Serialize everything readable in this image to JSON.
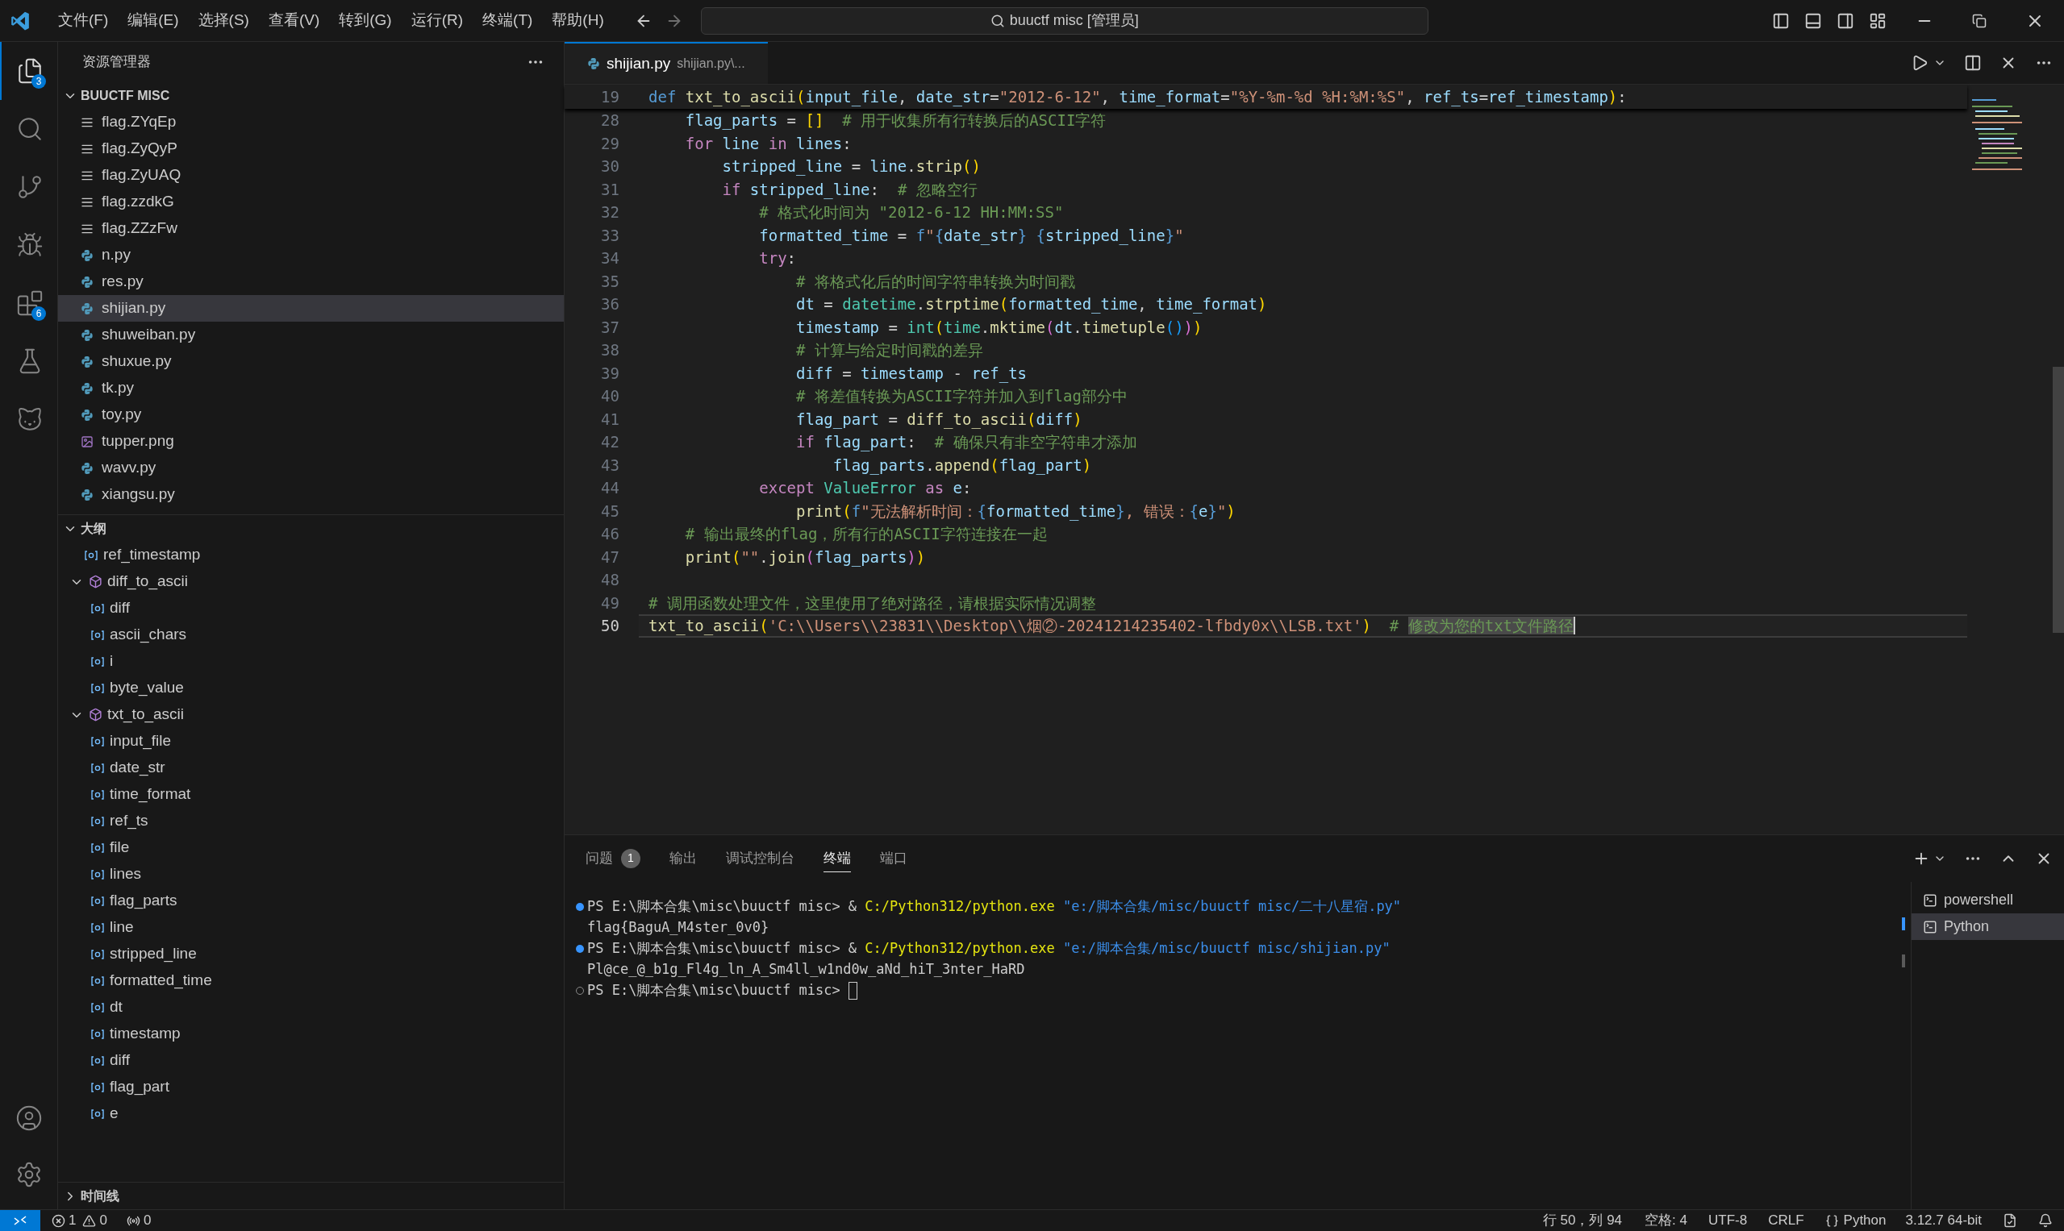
{
  "menu": [
    "文件(F)",
    "编辑(E)",
    "选择(S)",
    "查看(V)",
    "转到(G)",
    "运行(R)",
    "终端(T)",
    "帮助(H)"
  ],
  "command_center": {
    "text": "buuctf misc [管理员]"
  },
  "activity_bar": [
    {
      "kind": "explorer",
      "badge": "3",
      "selected": true
    },
    {
      "kind": "search",
      "selected": false
    },
    {
      "kind": "source-control",
      "selected": false
    },
    {
      "kind": "run",
      "selected": false
    },
    {
      "kind": "extensions",
      "badge": "6",
      "selected": false
    },
    {
      "kind": "testing",
      "selected": false
    },
    {
      "kind": "cat",
      "selected": false
    }
  ],
  "sidebar": {
    "title": "资源管理器",
    "folder": {
      "name": "BUUCTF MISC",
      "expanded": true
    },
    "files": [
      {
        "name": "flag.ZYqEp",
        "kind": "text",
        "selected": false
      },
      {
        "name": "flag.ZyQyP",
        "kind": "text",
        "selected": false
      },
      {
        "name": "flag.ZyUAQ",
        "kind": "text",
        "selected": false
      },
      {
        "name": "flag.zzdkG",
        "kind": "text",
        "selected": false
      },
      {
        "name": "flag.ZZzFw",
        "kind": "text",
        "selected": false
      },
      {
        "name": "n.py",
        "kind": "python",
        "selected": false
      },
      {
        "name": "res.py",
        "kind": "python",
        "selected": false
      },
      {
        "name": "shijian.py",
        "kind": "python",
        "selected": true
      },
      {
        "name": "shuweiban.py",
        "kind": "python",
        "selected": false
      },
      {
        "name": "shuxue.py",
        "kind": "python",
        "selected": false
      },
      {
        "name": "tk.py",
        "kind": "python",
        "selected": false
      },
      {
        "name": "toy.py",
        "kind": "python",
        "selected": false
      },
      {
        "name": "tupper.png",
        "kind": "image",
        "selected": false
      },
      {
        "name": "wavv.py",
        "kind": "python",
        "selected": false
      },
      {
        "name": "xiangsu.py",
        "kind": "python",
        "selected": false
      }
    ],
    "outline": {
      "title": "大纲",
      "expanded": true,
      "items": [
        {
          "name": "ref_timestamp",
          "kind": "variable"
        },
        {
          "name": "diff_to_ascii",
          "kind": "function",
          "expanded": true,
          "children": [
            {
              "name": "diff",
              "kind": "variable"
            },
            {
              "name": "ascii_chars",
              "kind": "variable"
            },
            {
              "name": "i",
              "kind": "variable"
            },
            {
              "name": "byte_value",
              "kind": "variable"
            }
          ]
        },
        {
          "name": "txt_to_ascii",
          "kind": "function",
          "expanded": true,
          "children": [
            {
              "name": "input_file",
              "kind": "variable"
            },
            {
              "name": "date_str",
              "kind": "variable"
            },
            {
              "name": "time_format",
              "kind": "variable"
            },
            {
              "name": "ref_ts",
              "kind": "variable"
            },
            {
              "name": "file",
              "kind": "variable"
            },
            {
              "name": "lines",
              "kind": "variable"
            },
            {
              "name": "flag_parts",
              "kind": "variable"
            },
            {
              "name": "line",
              "kind": "variable"
            },
            {
              "name": "stripped_line",
              "kind": "variable"
            },
            {
              "name": "formatted_time",
              "kind": "variable"
            },
            {
              "name": "dt",
              "kind": "variable"
            },
            {
              "name": "timestamp",
              "kind": "variable"
            },
            {
              "name": "diff",
              "kind": "variable"
            },
            {
              "name": "flag_part",
              "kind": "variable"
            },
            {
              "name": "e",
              "kind": "variable"
            }
          ]
        }
      ]
    },
    "timeline": {
      "title": "时间线",
      "expanded": false
    }
  },
  "editor": {
    "tab": {
      "name": "shijian.py",
      "description": "shijian.py\\..."
    },
    "sticky_line": {
      "number": "19",
      "tokens": [
        {
          "kind": "kw",
          "text": "def "
        },
        {
          "kind": "fn",
          "text": "txt_to_ascii"
        },
        {
          "kind": "b1",
          "text": "("
        },
        {
          "kind": "var",
          "text": "input_file"
        },
        {
          "kind": "op",
          "text": ", "
        },
        {
          "kind": "var",
          "text": "date_str"
        },
        {
          "kind": "op",
          "text": "="
        },
        {
          "kind": "str",
          "text": "\"2012-6-12\""
        },
        {
          "kind": "op",
          "text": ", "
        },
        {
          "kind": "var",
          "text": "time_format"
        },
        {
          "kind": "op",
          "text": "="
        },
        {
          "kind": "str",
          "text": "\"%Y-%m-%d %H:%M:%S\""
        },
        {
          "kind": "op",
          "text": ", "
        },
        {
          "kind": "var",
          "text": "ref_ts"
        },
        {
          "kind": "op",
          "text": "="
        },
        {
          "kind": "var",
          "text": "ref_timestamp"
        },
        {
          "kind": "b1",
          "text": ")"
        },
        {
          "kind": "op",
          "text": ":"
        }
      ]
    },
    "lines": [
      {
        "number": "28",
        "current": false,
        "tokens": [
          {
            "kind": "var",
            "text": "    flag_parts"
          },
          {
            "kind": "op",
            "text": " = "
          },
          {
            "kind": "b1",
            "text": "[]"
          },
          {
            "kind": "com",
            "text": "  # 用于收集所有行转换后的ASCII字符"
          }
        ]
      },
      {
        "number": "29",
        "current": false,
        "tokens": [
          {
            "kind": "ctl",
            "text": "    for"
          },
          {
            "kind": "var",
            "text": " line "
          },
          {
            "kind": "ctl",
            "text": "in"
          },
          {
            "kind": "var",
            "text": " lines"
          },
          {
            "kind": "op",
            "text": ":"
          }
        ]
      },
      {
        "number": "30",
        "current": false,
        "tokens": [
          {
            "kind": "var",
            "text": "        stripped_line"
          },
          {
            "kind": "op",
            "text": " = "
          },
          {
            "kind": "var",
            "text": "line"
          },
          {
            "kind": "op",
            "text": "."
          },
          {
            "kind": "fn",
            "text": "strip"
          },
          {
            "kind": "b1",
            "text": "()"
          }
        ]
      },
      {
        "number": "31",
        "current": false,
        "tokens": [
          {
            "kind": "ctl",
            "text": "        if"
          },
          {
            "kind": "var",
            "text": " stripped_line"
          },
          {
            "kind": "op",
            "text": ":"
          },
          {
            "kind": "com",
            "text": "  # 忽略空行"
          }
        ]
      },
      {
        "number": "32",
        "current": false,
        "tokens": [
          {
            "kind": "com",
            "text": "            # 格式化时间为 \"2012-6-12 HH:MM:SS\""
          }
        ]
      },
      {
        "number": "33",
        "current": false,
        "tokens": [
          {
            "kind": "var",
            "text": "            formatted_time"
          },
          {
            "kind": "op",
            "text": " = "
          },
          {
            "kind": "kw",
            "text": "f"
          },
          {
            "kind": "str",
            "text": "\""
          },
          {
            "kind": "kw",
            "text": "{"
          },
          {
            "kind": "var",
            "text": "date_str"
          },
          {
            "kind": "kw",
            "text": "} {"
          },
          {
            "kind": "var",
            "text": "stripped_line"
          },
          {
            "kind": "kw",
            "text": "}"
          },
          {
            "kind": "str",
            "text": "\""
          }
        ]
      },
      {
        "number": "34",
        "current": false,
        "tokens": [
          {
            "kind": "ctl",
            "text": "            try"
          },
          {
            "kind": "op",
            "text": ":"
          }
        ]
      },
      {
        "number": "35",
        "current": false,
        "tokens": [
          {
            "kind": "com",
            "text": "                # 将格式化后的时间字符串转换为时间戳"
          }
        ]
      },
      {
        "number": "36",
        "current": false,
        "tokens": [
          {
            "kind": "var",
            "text": "                dt"
          },
          {
            "kind": "op",
            "text": " = "
          },
          {
            "kind": "cls",
            "text": "datetime"
          },
          {
            "kind": "op",
            "text": "."
          },
          {
            "kind": "fn",
            "text": "strptime"
          },
          {
            "kind": "b1",
            "text": "("
          },
          {
            "kind": "var",
            "text": "formatted_time"
          },
          {
            "kind": "op",
            "text": ", "
          },
          {
            "kind": "var",
            "text": "time_format"
          },
          {
            "kind": "b1",
            "text": ")"
          }
        ]
      },
      {
        "number": "37",
        "current": false,
        "tokens": [
          {
            "kind": "var",
            "text": "                timestamp"
          },
          {
            "kind": "op",
            "text": " = "
          },
          {
            "kind": "cls",
            "text": "int"
          },
          {
            "kind": "b1",
            "text": "("
          },
          {
            "kind": "cls",
            "text": "time"
          },
          {
            "kind": "op",
            "text": "."
          },
          {
            "kind": "fn",
            "text": "mktime"
          },
          {
            "kind": "b2",
            "text": "("
          },
          {
            "kind": "var",
            "text": "dt"
          },
          {
            "kind": "op",
            "text": "."
          },
          {
            "kind": "fn",
            "text": "timetuple"
          },
          {
            "kind": "b3",
            "text": "()"
          },
          {
            "kind": "b2",
            "text": ")"
          },
          {
            "kind": "b1",
            "text": ")"
          }
        ]
      },
      {
        "number": "38",
        "current": false,
        "tokens": [
          {
            "kind": "com",
            "text": "                # 计算与给定时间戳的差异"
          }
        ]
      },
      {
        "number": "39",
        "current": false,
        "tokens": [
          {
            "kind": "var",
            "text": "                diff"
          },
          {
            "kind": "op",
            "text": " = "
          },
          {
            "kind": "var",
            "text": "timestamp"
          },
          {
            "kind": "op",
            "text": " - "
          },
          {
            "kind": "var",
            "text": "ref_ts"
          }
        ]
      },
      {
        "number": "40",
        "current": false,
        "tokens": [
          {
            "kind": "com",
            "text": "                # 将差值转换为ASCII字符并加入到flag部分中"
          }
        ]
      },
      {
        "number": "41",
        "current": false,
        "tokens": [
          {
            "kind": "var",
            "text": "                flag_part"
          },
          {
            "kind": "op",
            "text": " = "
          },
          {
            "kind": "fn",
            "text": "diff_to_ascii"
          },
          {
            "kind": "b1",
            "text": "("
          },
          {
            "kind": "var",
            "text": "diff"
          },
          {
            "kind": "b1",
            "text": ")"
          }
        ]
      },
      {
        "number": "42",
        "current": false,
        "tokens": [
          {
            "kind": "ctl",
            "text": "                if"
          },
          {
            "kind": "var",
            "text": " flag_part"
          },
          {
            "kind": "op",
            "text": ":"
          },
          {
            "kind": "com",
            "text": "  # 确保只有非空字符串才添加"
          }
        ]
      },
      {
        "number": "43",
        "current": false,
        "tokens": [
          {
            "kind": "var",
            "text": "                    flag_parts"
          },
          {
            "kind": "op",
            "text": "."
          },
          {
            "kind": "fn",
            "text": "append"
          },
          {
            "kind": "b1",
            "text": "("
          },
          {
            "kind": "var",
            "text": "flag_part"
          },
          {
            "kind": "b1",
            "text": ")"
          }
        ]
      },
      {
        "number": "44",
        "current": false,
        "tokens": [
          {
            "kind": "ctl",
            "text": "            except"
          },
          {
            "kind": "cls",
            "text": " ValueError "
          },
          {
            "kind": "ctl",
            "text": "as"
          },
          {
            "kind": "var",
            "text": " e"
          },
          {
            "kind": "op",
            "text": ":"
          }
        ]
      },
      {
        "number": "45",
        "current": false,
        "tokens": [
          {
            "kind": "fn",
            "text": "                print"
          },
          {
            "kind": "b1",
            "text": "("
          },
          {
            "kind": "kw",
            "text": "f"
          },
          {
            "kind": "str",
            "text": "\"无法解析时间："
          },
          {
            "kind": "kw",
            "text": "{"
          },
          {
            "kind": "var",
            "text": "formatted_time"
          },
          {
            "kind": "kw",
            "text": "}"
          },
          {
            "kind": "str",
            "text": ", 错误："
          },
          {
            "kind": "kw",
            "text": "{"
          },
          {
            "kind": "var",
            "text": "e"
          },
          {
            "kind": "kw",
            "text": "}"
          },
          {
            "kind": "str",
            "text": "\""
          },
          {
            "kind": "b1",
            "text": ")"
          }
        ]
      },
      {
        "number": "46",
        "current": false,
        "tokens": [
          {
            "kind": "com",
            "text": "    # 输出最终的flag，所有行的ASCII字符连接在一起"
          }
        ]
      },
      {
        "number": "47",
        "current": false,
        "tokens": [
          {
            "kind": "fn",
            "text": "    print"
          },
          {
            "kind": "b1",
            "text": "("
          },
          {
            "kind": "str",
            "text": "\"\""
          },
          {
            "kind": "op",
            "text": "."
          },
          {
            "kind": "fn",
            "text": "join"
          },
          {
            "kind": "b2",
            "text": "("
          },
          {
            "kind": "var",
            "text": "flag_parts"
          },
          {
            "kind": "b2",
            "text": ")"
          },
          {
            "kind": "b1",
            "text": ")"
          }
        ]
      },
      {
        "number": "48",
        "current": false
      },
      {
        "number": "49",
        "current": false,
        "tokens": [
          {
            "kind": "com",
            "text": "# 调用函数处理文件，这里使用了绝对路径，请根据实际情况调整"
          }
        ]
      },
      {
        "number": "50",
        "current": true,
        "tokens": [
          {
            "kind": "fn",
            "text": "txt_to_ascii"
          },
          {
            "kind": "b1",
            "text": "("
          },
          {
            "kind": "str",
            "text": "'C:\\\\Users\\\\23831\\\\Desktop\\\\烟②-20241214235402-lfbdy0x\\\\LSB.txt'"
          },
          {
            "kind": "b1",
            "text": ")"
          },
          {
            "kind": "com",
            "text": "  # "
          },
          {
            "kind": "sel",
            "text": "修改为您的txt文件路径"
          }
        ]
      }
    ]
  },
  "panel": {
    "tabs": [
      {
        "label": "问题",
        "badge": "1",
        "selected": false
      },
      {
        "label": "输出",
        "selected": false
      },
      {
        "label": "调试控制台",
        "selected": false
      },
      {
        "label": "终端",
        "selected": true
      },
      {
        "label": "端口",
        "selected": false
      }
    ],
    "terminal_lines": [
      {
        "kind": "success",
        "tokens": [
          {
            "kind": "op",
            "text": "PS E:\\脚本合集\\misc\\buuctf misc> & "
          },
          {
            "kind": "fn",
            "text": "C:/Python312/python.exe"
          },
          {
            "kind": "var",
            "text": " \"e:/脚本合集/misc/buuctf misc/二十八星宿.py\""
          }
        ]
      },
      {
        "kind": "output",
        "tokens": [
          {
            "kind": "op",
            "text": "flag{BaguA_M4ster_0v0}"
          }
        ]
      },
      {
        "kind": "success",
        "tokens": [
          {
            "kind": "op",
            "text": "PS E:\\脚本合集\\misc\\buuctf misc> & "
          },
          {
            "kind": "fn",
            "text": "C:/Python312/python.exe"
          },
          {
            "kind": "var",
            "text": " \"e:/脚本合集/misc/buuctf misc/shijian.py\""
          }
        ]
      },
      {
        "kind": "output",
        "tokens": [
          {
            "kind": "op",
            "text": "Pl@ce_@_b1g_Fl4g_ln_A_Sm4ll_w1nd0w_aNd_hiT_3nter_HaRD"
          }
        ]
      },
      {
        "kind": "pending",
        "cursor": true,
        "tokens": [
          {
            "kind": "op",
            "text": "PS E:\\脚本合集\\misc\\buuctf misc> "
          }
        ]
      }
    ],
    "terminals": [
      {
        "name": "powershell",
        "selected": false
      },
      {
        "name": "Python",
        "selected": true
      }
    ]
  },
  "status_bar": {
    "errors": "1",
    "warnings": "0",
    "ports": "0",
    "position": "行 50，列 94",
    "indent": "空格: 4",
    "encoding": "UTF-8",
    "eol": "CRLF",
    "language": "Python",
    "interpreter": "3.12.7 64-bit"
  }
}
